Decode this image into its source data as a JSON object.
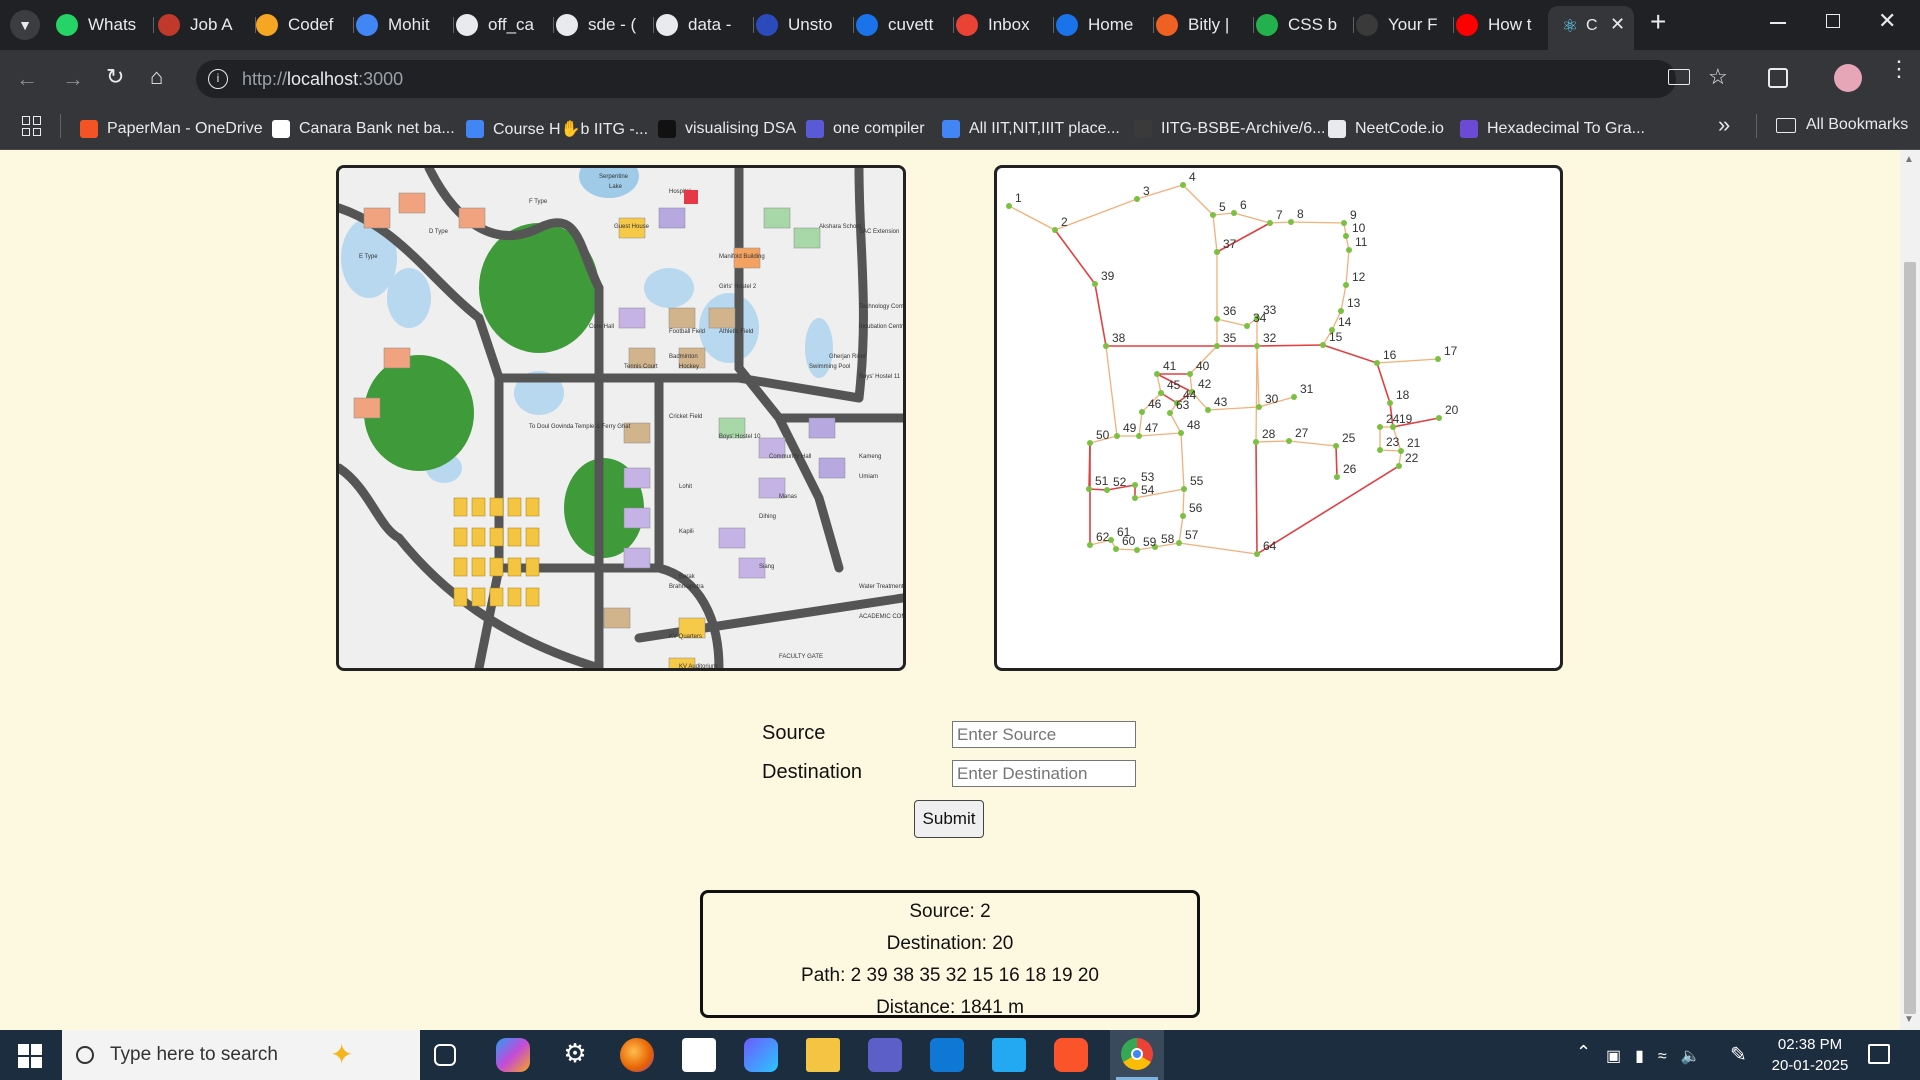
{
  "tabs": [
    {
      "label": "Whats",
      "color": "#25d366"
    },
    {
      "label": "Job A",
      "color": "#c0392b"
    },
    {
      "label": "Codef",
      "color": "#f5a623"
    },
    {
      "label": "Mohit",
      "color": "#4285f4"
    },
    {
      "label": "off_ca",
      "color": "#e8eaed"
    },
    {
      "label": "sde - (",
      "color": "#e8eaed"
    },
    {
      "label": "data -",
      "color": "#e8eaed"
    },
    {
      "label": "Unsto",
      "color": "#2b4bbd"
    },
    {
      "label": "cuvett",
      "color": "#1a73e8"
    },
    {
      "label": "Inbox",
      "color": "#ea4335"
    },
    {
      "label": "Home",
      "color": "#1a73e8"
    },
    {
      "label": "Bitly |",
      "color": "#ee6123"
    },
    {
      "label": "CSS b",
      "color": "#22b14c"
    },
    {
      "label": "Your F",
      "color": "#3a3a3a"
    },
    {
      "label": "How t",
      "color": "#ff0000"
    }
  ],
  "active_tab": {
    "label": "C",
    "icon": "react-icon"
  },
  "address": {
    "scheme": "http://",
    "host": "localhost",
    "rest": ":3000"
  },
  "bookmarks": [
    {
      "label": "PaperMan - OneDrive",
      "color": "#f35325"
    },
    {
      "label": "Canara Bank net ba...",
      "color": "#ffffff"
    },
    {
      "label": "Course H✋b IITG -...",
      "color": "#4285f4"
    },
    {
      "label": "visualising DSA",
      "color": "#111111"
    },
    {
      "label": "one compiler",
      "color": "#5a5ad6"
    },
    {
      "label": "All IIT,NIT,IIIT place...",
      "color": "#4285f4"
    },
    {
      "label": "IITG-BSBE-Archive/6...",
      "color": "#3a3a3a"
    },
    {
      "label": "NeetCode.io",
      "color": "#e8eaed"
    },
    {
      "label": "Hexadecimal To Gra...",
      "color": "#6b4bd6"
    }
  ],
  "all_bookmarks": "All Bookmarks",
  "form": {
    "source_label": "Source",
    "destination_label": "Destination",
    "source_placeholder": "Enter Source",
    "destination_placeholder": "Enter Destination",
    "submit_label": "Submit"
  },
  "result": {
    "source": "Source: 2",
    "destination": "Destination: 20",
    "path": "Path: 2 39 38 35 32 15 16 18 19 20",
    "distance": "Distance:  1841 m"
  },
  "graph": {
    "node_labels": [
      "1",
      "2",
      "3",
      "4",
      "5",
      "6",
      "7",
      "8",
      "9",
      "10",
      "11",
      "12",
      "13",
      "14",
      "15",
      "16",
      "17",
      "18",
      "19",
      "20",
      "21",
      "22",
      "23",
      "24",
      "25",
      "26",
      "27",
      "28",
      "30",
      "31",
      "32",
      "33",
      "34",
      "35",
      "36",
      "37",
      "38",
      "39",
      "40",
      "41",
      "42",
      "43",
      "44",
      "45",
      "46",
      "47",
      "48",
      "49",
      "50",
      "51",
      "52",
      "53",
      "54",
      "55",
      "56",
      "57",
      "58",
      "59",
      "60",
      "61",
      "62",
      "63",
      "64"
    ],
    "path_color": "#e04040",
    "edge_color": "#f2b07a",
    "node_color": "#7ac142"
  },
  "campus_map": {
    "labels": [
      "D Type",
      "E Type",
      "F Type",
      "Guest House",
      "Hospital",
      "Akshara School",
      "SAC Extension",
      "Manifold Building",
      "Girls' Hostel 2",
      "Technology Complex",
      "Incubation Centre",
      "Football Field",
      "Athletic Field",
      "Badminton",
      "Tennis Court",
      "Hockey",
      "Cricket Field",
      "Swimming Pool",
      "Gherjan River",
      "Boys' Hostel 11",
      "Boys' Hostel 10",
      "Community Hall",
      "Manas",
      "Dihing",
      "Lohit",
      "Kapili",
      "Umiam",
      "Kameng",
      "Barak",
      "Siang",
      "Brahmaputra",
      "KV Quarters",
      "KV Auditorium",
      "Water Treatment Plant",
      "FACULTY GATE",
      "ACADEMIC COMPLEX",
      "To Doul Govinda Temple & Ferry Ghat",
      "Core Hall",
      "Lake",
      "Serpentine"
    ]
  },
  "taskbar": {
    "search_placeholder": "Type here to search",
    "time": "02:38 PM",
    "date": "20-01-2025"
  }
}
